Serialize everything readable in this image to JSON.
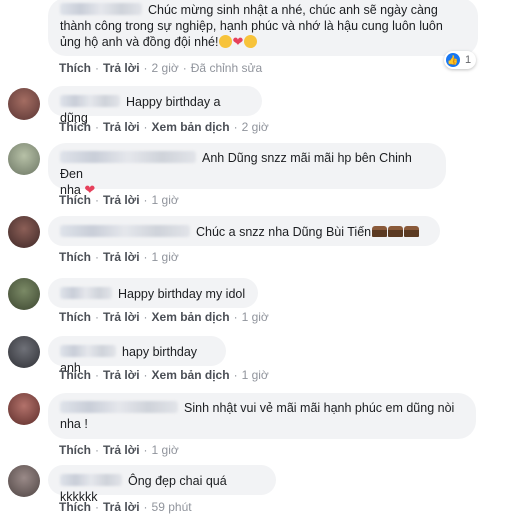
{
  "comments": [
    {
      "text_line1": "Chúc mừng sinh nhật a nhé, chúc anh sẽ ngày càng",
      "text_line2": "thành công trong sự nghiệp, hạnh phúc và nhớ là hậu cung luôn luôn",
      "text_line3": "ủng hộ anh và đồng đội nhé!",
      "emojis": [
        "heart-eyes-emoji",
        "heart-emoji",
        "tongue-emoji"
      ],
      "actions": {
        "like": "Thích",
        "reply": "Trả lời",
        "time": "2 giờ",
        "extra": "Đã chỉnh sửa"
      },
      "reaction_count": "1"
    },
    {
      "text": "Happy birthday a dũng",
      "actions": {
        "like": "Thích",
        "reply": "Trả lời",
        "translate": "Xem bản dịch",
        "time": "2 giờ"
      }
    },
    {
      "text_line1": "Anh Dũng snzz mãi mãi hp bên Chinh Đen",
      "text_line2": "nha",
      "actions": {
        "like": "Thích",
        "reply": "Trả lời",
        "time": "1 giờ"
      }
    },
    {
      "text": "Chúc a snzz nha Dũng Bùi Tiến",
      "actions": {
        "like": "Thích",
        "reply": "Trả lời",
        "time": "1 giờ"
      }
    },
    {
      "text": "Happy birthday my idol",
      "actions": {
        "like": "Thích",
        "reply": "Trả lời",
        "translate": "Xem bản dịch",
        "time": "1 giờ"
      }
    },
    {
      "text": "hapy birthday anh",
      "actions": {
        "like": "Thích",
        "reply": "Trả lời",
        "translate": "Xem bản dịch",
        "time": "1 giờ"
      }
    },
    {
      "text_line1": "Sinh nhật vui vẻ mãi mãi hạnh phúc em dũng nòi",
      "text_line2": "nha !",
      "actions": {
        "like": "Thích",
        "reply": "Trả lời",
        "time": "1 giờ"
      }
    },
    {
      "text": "Ông đẹp chai quá kkkkkk",
      "actions": {
        "like": "Thích",
        "reply": "Trả lời",
        "time": "59 phút"
      }
    }
  ]
}
